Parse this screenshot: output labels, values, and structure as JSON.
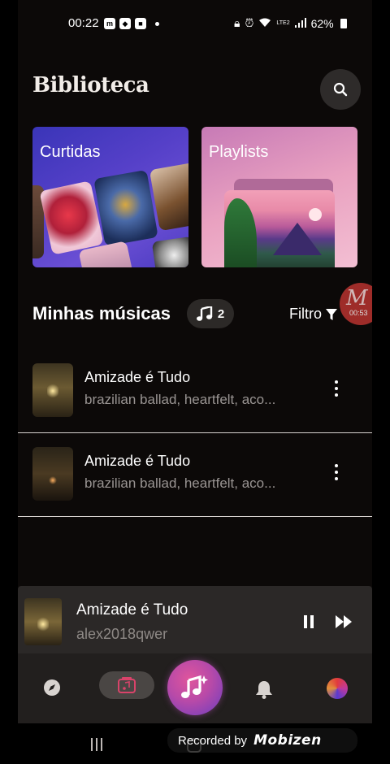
{
  "status_bar": {
    "time": "00:22",
    "network": "LTE2",
    "battery": "62%"
  },
  "header": {
    "title": "Biblioteca"
  },
  "cards": [
    {
      "label": "Curtidas"
    },
    {
      "label": "Playlists"
    }
  ],
  "section": {
    "title": "Minhas músicas",
    "count": "2",
    "filter_label": "Filtro"
  },
  "recording_badge": {
    "letter": "M",
    "time": "00:53"
  },
  "songs": [
    {
      "title": "Amizade é Tudo",
      "description": "brazilian ballad, heartfelt, aco..."
    },
    {
      "title": "Amizade é Tudo",
      "description": "brazilian ballad, heartfelt, aco..."
    }
  ],
  "player": {
    "title": "Amizade é Tudo",
    "artist": "alex2018qwer"
  },
  "watermark": {
    "label": "Recorded by",
    "brand": "Mobizen"
  },
  "colors": {
    "background": "#0c0908",
    "accent": "#b84aa8",
    "player_bg": "#2b2827"
  }
}
